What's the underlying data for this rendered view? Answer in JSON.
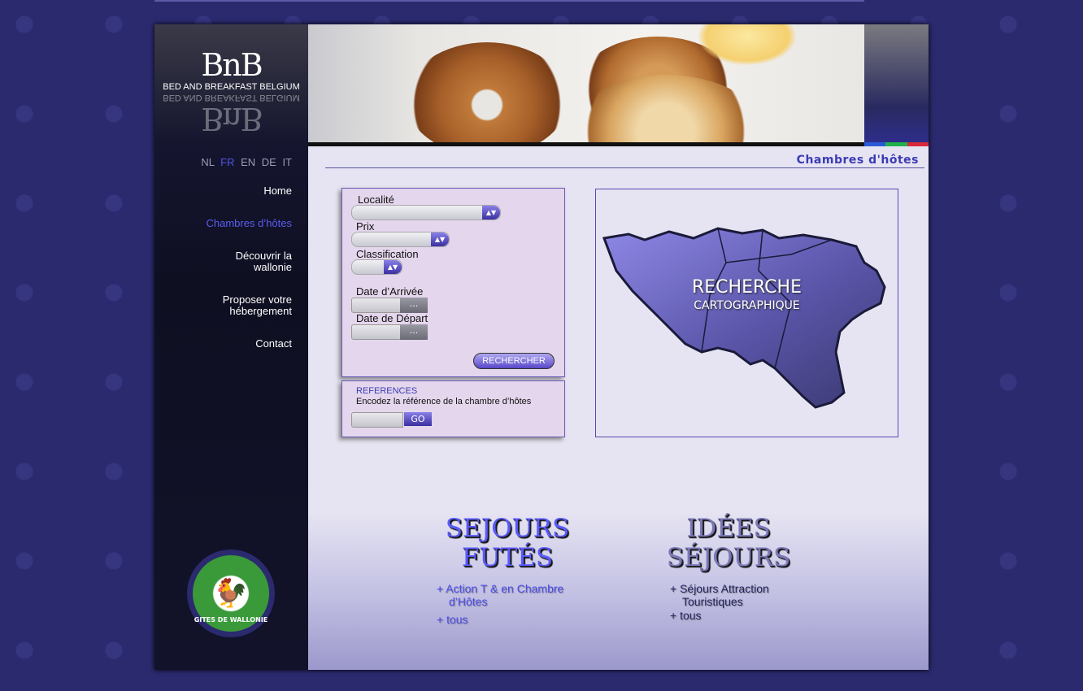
{
  "logo": {
    "main": "BnB",
    "sub": "BED AND BREAKFAST BELGIUM"
  },
  "languages": [
    {
      "code": "NL",
      "active": false
    },
    {
      "code": "FR",
      "active": true
    },
    {
      "code": "EN",
      "active": false
    },
    {
      "code": "DE",
      "active": false
    },
    {
      "code": "IT",
      "active": false
    }
  ],
  "nav": {
    "home": "Home",
    "chambres": "Chambres d’hôtes",
    "decouvrir_1": "Découvrir la",
    "decouvrir_2": "wallonie",
    "proposer_1": "Proposer votre",
    "proposer_2": "hébergement",
    "contact": "Contact"
  },
  "partner": {
    "text": "GITES DE WALLONIE"
  },
  "page_title": "Chambres d'hôtes",
  "search": {
    "localite_label": "Localité",
    "prix_label": "Prix",
    "classification_label": "Classification",
    "arrivee_label": "Date d’Arrivée",
    "depart_label": "Date de Départ",
    "date_button": "...",
    "search_button": "RECHERCHER"
  },
  "references": {
    "title": "REFERENCES",
    "hint": "Encodez la référence de la chambre d’hôtes",
    "go_button": "GO"
  },
  "map": {
    "line1": "RECHERCHE",
    "line2": "CARTOGRAPHIQUE"
  },
  "sejours_futes": {
    "title_1": "SEJOURS",
    "title_2": "FUTÉS",
    "link1_a": "+ Action T & en Chambre",
    "link1_b": "d’Hôtes",
    "link2": "+ tous"
  },
  "idees_sejours": {
    "title_1": "IDÉES",
    "title_2": "SÉJOURS",
    "link1_a": "+ Séjours Attraction",
    "link1_b": "Touristiques",
    "link2": "+ tous"
  },
  "colors": {
    "accent": "#3b3bb5",
    "background": "#2b2a6e",
    "active_link": "#5a5ef0"
  }
}
